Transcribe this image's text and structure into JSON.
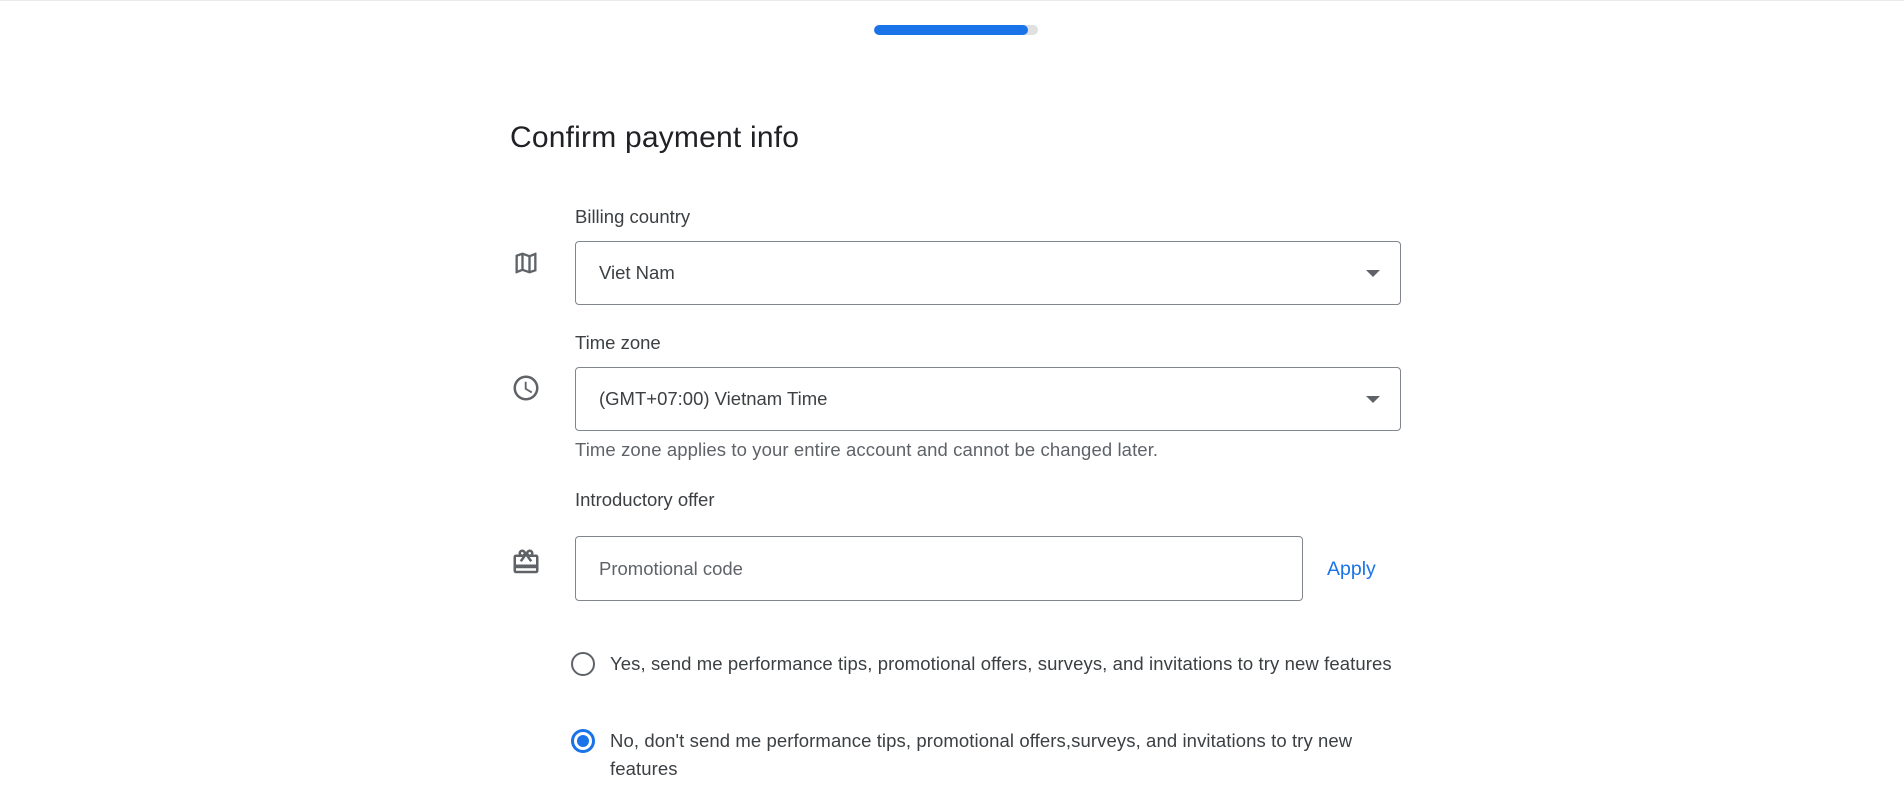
{
  "progress": {
    "value": 0.94
  },
  "page": {
    "title": "Confirm payment info"
  },
  "billing_country": {
    "label": "Billing country",
    "value": "Viet Nam",
    "icon": "map-icon"
  },
  "time_zone": {
    "label": "Time zone",
    "value": "(GMT+07:00) Vietnam Time",
    "helper": "Time zone applies to your entire account and cannot be changed later.",
    "icon": "clock-icon"
  },
  "intro_offer": {
    "label": "Introductory offer",
    "placeholder": "Promotional code",
    "value": "",
    "apply_label": "Apply",
    "icon": "gift-card-icon"
  },
  "email_prefs": {
    "options": [
      {
        "label": "Yes, send me performance tips, promotional offers, surveys, and invitations to try new features",
        "checked": false
      },
      {
        "label": "No, don't send me performance tips, promotional offers,surveys, and invitations to try new features",
        "checked": true
      }
    ]
  },
  "colors": {
    "accent": "#1a73e8",
    "border": "#80868b",
    "text": "#3c4043",
    "icon": "#5f6368"
  }
}
